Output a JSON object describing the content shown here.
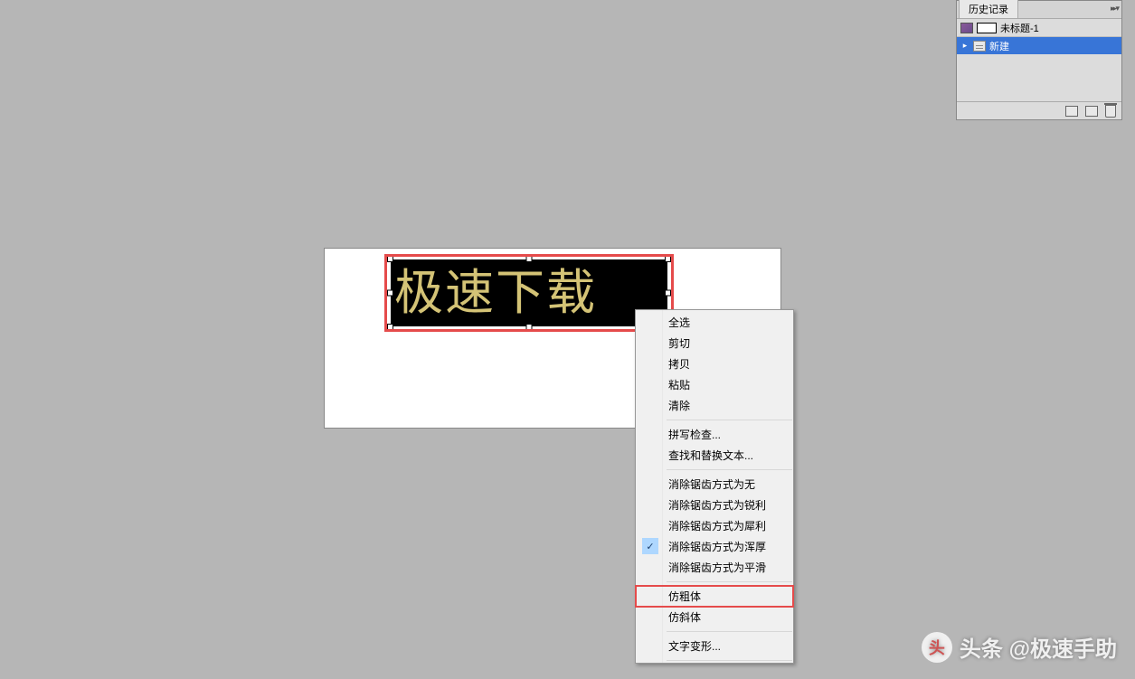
{
  "canvas": {
    "text_content": "极速下载"
  },
  "context_menu": {
    "items": [
      {
        "label": "全选",
        "checked": false,
        "highlighted": false
      },
      {
        "label": "剪切",
        "checked": false,
        "highlighted": false
      },
      {
        "label": "拷贝",
        "checked": false,
        "highlighted": false
      },
      {
        "label": "粘贴",
        "checked": false,
        "highlighted": false
      },
      {
        "label": "清除",
        "checked": false,
        "highlighted": false
      }
    ],
    "items2": [
      {
        "label": "拼写检查...",
        "checked": false,
        "highlighted": false
      },
      {
        "label": "查找和替换文本...",
        "checked": false,
        "highlighted": false
      }
    ],
    "items3": [
      {
        "label": "消除锯齿方式为无",
        "checked": false,
        "highlighted": false
      },
      {
        "label": "消除锯齿方式为锐利",
        "checked": false,
        "highlighted": false
      },
      {
        "label": "消除锯齿方式为犀利",
        "checked": false,
        "highlighted": false
      },
      {
        "label": "消除锯齿方式为浑厚",
        "checked": true,
        "highlighted": false
      },
      {
        "label": "消除锯齿方式为平滑",
        "checked": false,
        "highlighted": false
      }
    ],
    "items4": [
      {
        "label": "仿粗体",
        "checked": false,
        "highlighted": true
      },
      {
        "label": "仿斜体",
        "checked": false,
        "highlighted": false
      }
    ],
    "items5": [
      {
        "label": "文字变形...",
        "checked": false,
        "highlighted": false
      }
    ]
  },
  "history_panel": {
    "tab_label": "历史记录",
    "doc_name": "未标题-1",
    "steps": [
      {
        "label": "新建"
      }
    ]
  },
  "watermark": {
    "logo_text": "头",
    "text": "头条 @极速手助"
  }
}
